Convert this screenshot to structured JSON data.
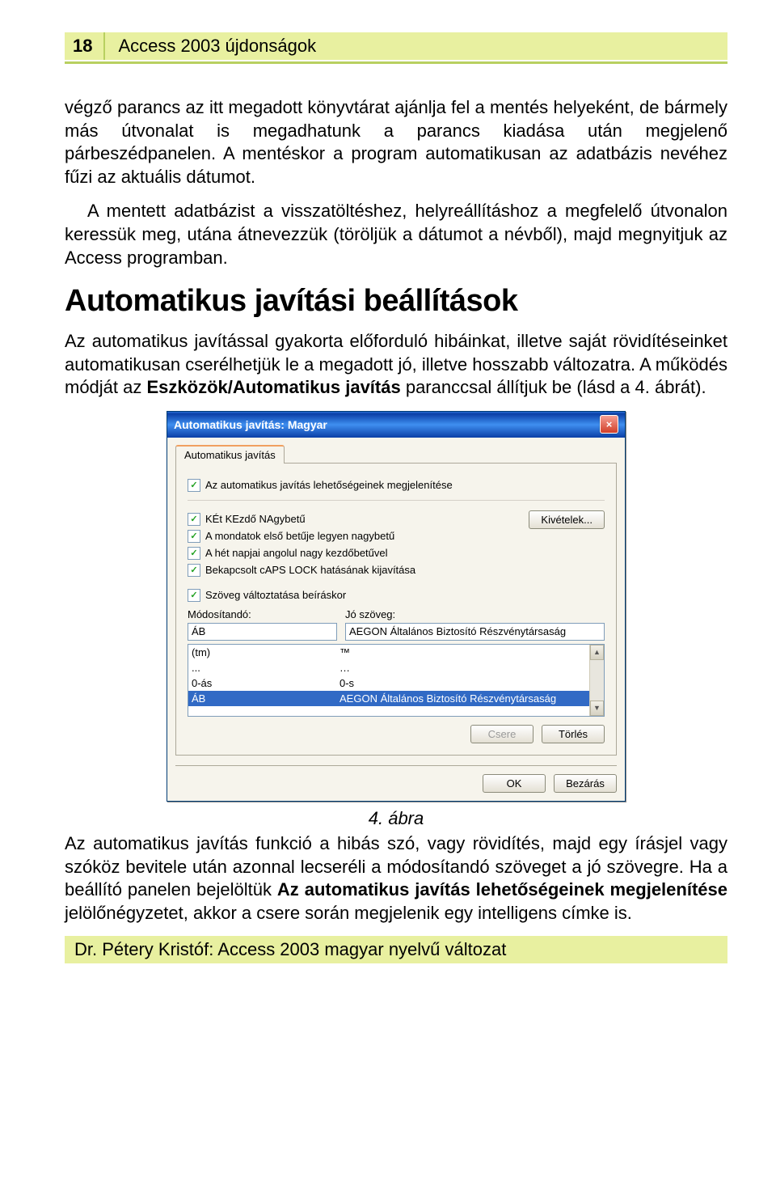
{
  "header": {
    "page_number": "18",
    "title": "Access 2003 újdonságok"
  },
  "body": {
    "para1": "végző parancs az itt megadott könyvtárat ajánlja fel a mentés helyeként, de bármely más útvonalat is megadhatunk a parancs kiadása után megjelenő párbeszédpanelen. A mentéskor a program automatikusan az adatbázis nevéhez fűzi az aktuális dátumot.",
    "para2": "A mentett adatbázist a visszatöltéshez, helyreállításhoz a megfelelő útvonalon keressük meg, utána átnevezzük (töröljük a dátumot a névből), majd megnyitjuk az Access programban.",
    "heading": "Automatikus javítási beállítások",
    "para3a": "Az automatikus javítással gyakorta előforduló hibáinkat, illetve saját rövidítéseinket automatikusan cserélhetjük le a megadott jó, illetve hosszabb változatra. A működés módját az ",
    "para3_bold1": "Eszközök/Automatikus javítás",
    "para3b": " paranccsal állítjuk be (lásd a 4. ábrát).",
    "caption": "4. ábra",
    "para4a": "Az automatikus javítás funkció a hibás szó, vagy rövidítés, majd egy írásjel vagy szóköz bevitele után azonnal lecseréli a módosítandó szöveget a jó szövegre. Ha a beállító panelen bejelöltük ",
    "para4_bold1": "Az automatikus javítás lehetőségeinek megjelenítése",
    "para4b": " jelölőnégyzetet, akkor a csere során megjelenik egy intelligens címke is."
  },
  "dialog": {
    "title": "Automatikus javítás: Magyar",
    "close": "×",
    "tab": "Automatikus javítás",
    "cb1": "Az automatikus javítás lehetőségeinek megjelenítése",
    "cb2": "KÉt KEzdő NAgybetű",
    "cb3": "A mondatok első betűje legyen nagybetű",
    "cb4": "A hét napjai angolul nagy kezdőbetűvel",
    "cb5": "Bekapcsolt cAPS LOCK hatásának kijavítása",
    "cb6": "Szöveg változtatása beíráskor",
    "btn_exceptions": "Kivételek...",
    "label_replace": "Módosítandó:",
    "label_with": "Jó szöveg:",
    "input_replace": "ÁB",
    "input_with": "AEGON Általános Biztosító Részvénytársaság",
    "list": [
      {
        "l": "(tm)",
        "r": "™"
      },
      {
        "l": "...",
        "r": "…"
      },
      {
        "l": "0-ás",
        "r": "0-s"
      },
      {
        "l": "ÁB",
        "r": "AEGON Általános Biztosító Részvénytársaság"
      }
    ],
    "btn_replace": "Csere",
    "btn_delete": "Törlés",
    "btn_ok": "OK",
    "btn_close": "Bezárás"
  },
  "footer": {
    "credit": "Dr. Pétery Kristóf: Access 2003 magyar nyelvű változat"
  }
}
